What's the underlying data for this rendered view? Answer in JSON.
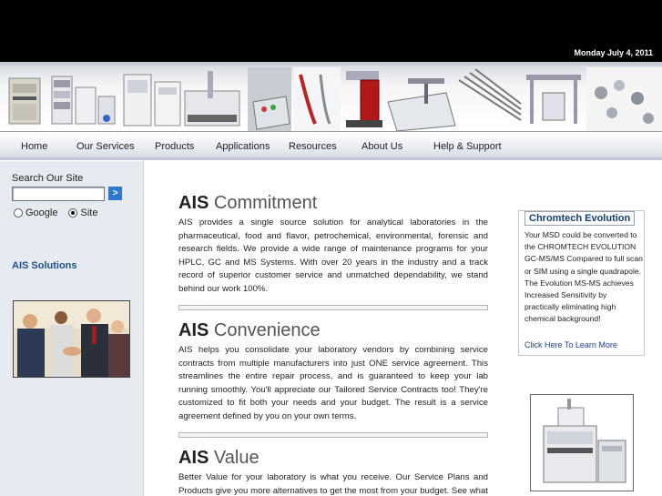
{
  "header": {
    "date": "Monday July 4, 2011"
  },
  "banner": {
    "icons": [
      "instrument-autosampler",
      "gc-instrument",
      "hplc-instrument",
      "syringe-icons"
    ]
  },
  "nav": {
    "items": [
      {
        "label": "Home"
      },
      {
        "label": "Our Services"
      },
      {
        "label": "Products"
      },
      {
        "label": "Applications"
      },
      {
        "label": "Resources"
      },
      {
        "label": "About Us"
      },
      {
        "label": "Help & Support"
      }
    ]
  },
  "sidebar": {
    "search_label": "Search Our Site",
    "search_value": "",
    "search_button": ">",
    "radio_google": "Google",
    "radio_site": "Site",
    "selected_radio": "Site",
    "solutions_title": "AIS Solutions"
  },
  "main": {
    "sections": [
      {
        "brand": "AIS",
        "title": "Commitment",
        "text": "AIS provides a single source solution for analytical laboratories in the pharmaceutical, food and flavor, petrochemical, environmental, forensic and research fields. We provide a wide range of maintenance programs for your HPLC, GC and MS Systems. With over 20 years in the industry and a track record of superior customer service and unmatched dependability, we stand behind our work 100%."
      },
      {
        "brand": "AIS",
        "title": "Convenience",
        "text": "AIS helps you consolidate your laboratory vendors by combining service contracts from multiple manufacturers into just ONE service agreement. This streamlines the entire repair process, and is guaranteed to keep your lab running smoothly. You'll appreciate our Tailored Service Contracts too! They're customized to fit both your needs and your budget. The result is a service agreement defined by you on your own terms."
      },
      {
        "brand": "AIS",
        "title": "Value",
        "text": "Better Value for your laboratory is what you receive. Our Service Plans and Products give you more alternatives to get the most from your budget. See what AIS can do for your laboratory. Today."
      }
    ]
  },
  "promo": {
    "title": "Chromtech Evolution",
    "text": "Your MSD could be converted to the CHROMTECH EVOLUTION GC-MS/MS Compared to full scan or SIM using a single quadrapole. The Evolution MS-MS achieves Increased Sensitivity by practically eliminating high chemical background!",
    "link": "Click Here To Learn More"
  }
}
